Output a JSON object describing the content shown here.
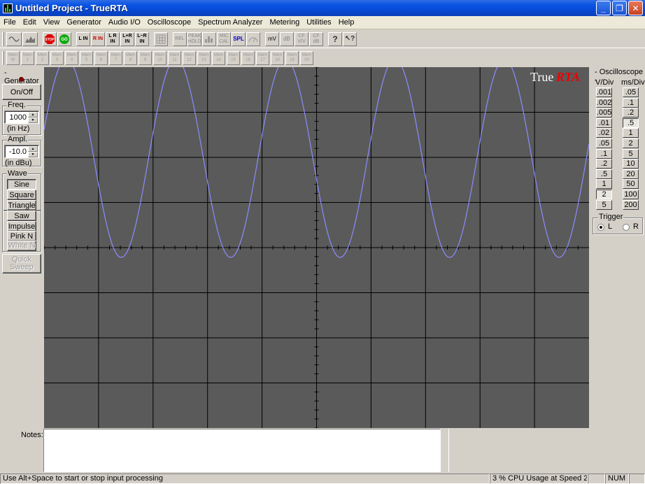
{
  "window": {
    "title": "Untitled Project - TrueRTA",
    "minimize_icon": "minimize-icon",
    "maximize_icon": "restore-icon",
    "close_icon": "close-icon"
  },
  "menu": [
    "File",
    "Edit",
    "View",
    "Generator",
    "Audio I/O",
    "Oscilloscope",
    "Spectrum Analyzer",
    "Metering",
    "Utilities",
    "Help"
  ],
  "toolbar": {
    "buttons": [
      {
        "label": "",
        "icon": "oscilloscope-mode-icon"
      },
      {
        "label": "",
        "icon": "spectrum-mode-icon"
      },
      {
        "label": "STOP",
        "icon": "stop-icon"
      },
      {
        "label": "GO",
        "icon": "go-icon"
      },
      {
        "label": "L IN"
      },
      {
        "label": "R IN"
      },
      {
        "label": "L R IN"
      },
      {
        "label": "L+R IN"
      },
      {
        "label": "L−R IN"
      },
      {
        "label": "",
        "icon": "grid-icon"
      },
      {
        "label": "REL"
      },
      {
        "label": "PEAK HOLD"
      },
      {
        "label": "",
        "icon": "bars-icon"
      },
      {
        "label": "MIC CAL"
      },
      {
        "label": "SPL"
      },
      {
        "label": "",
        "icon": "meter-icon"
      },
      {
        "label": "mV"
      },
      {
        "label": "dB"
      },
      {
        "label": "CF V/V"
      },
      {
        "label": "CF dB"
      },
      {
        "label": "?",
        "icon": "help-icon"
      },
      {
        "label": "",
        "icon": "context-help-icon"
      }
    ],
    "mem_buttons": [
      "Mem W",
      "Mem 1",
      "Mem 2",
      "Mem 3",
      "Mem 4",
      "Mem 5",
      "Mem 6",
      "Mem 7",
      "Mem 8",
      "Mem 9",
      "Mem 10",
      "Mem 11",
      "Mem 12",
      "Mem 13",
      "Mem 14",
      "Mem 15",
      "Mem 16",
      "Mem 17",
      "Mem 18",
      "Mem 19",
      "Mem 20"
    ]
  },
  "generator": {
    "title": "Generator",
    "on_off_label": "On/Off",
    "freq_label": "Freq.",
    "freq_value": "1000",
    "freq_unit": "(in Hz)",
    "ampl_label": "Ampl.",
    "ampl_value": "-10.0",
    "ampl_unit": "(in dBu)",
    "wave_label": "Wave",
    "waves": [
      "Sine",
      "Square",
      "Triangle",
      "Saw",
      "Impulse",
      "Pink N",
      "White N"
    ],
    "selected_wave": "Sine",
    "quick_sweep_label": "Quick Sweep"
  },
  "scope": {
    "logo_true": "True",
    "logo_rta": "RTA",
    "trace_color": "#8c8cff",
    "grid_color": "#000000",
    "background": "#5a5a5a",
    "waveform": {
      "cycles": 5,
      "clipped_bottom": true
    }
  },
  "oscilloscope": {
    "title": "Oscilloscope",
    "vdiv_header": "V/Div",
    "msdiv_header": "ms/Div",
    "vdiv": [
      ".001",
      ".002",
      ".005",
      ".01",
      ".02",
      ".05",
      ".1",
      ".2",
      ".5",
      "1",
      "2",
      "5"
    ],
    "msdiv": [
      ".05",
      ".1",
      ".2",
      ".5",
      "1",
      "2",
      "5",
      "10",
      "20",
      "50",
      "100",
      "200"
    ],
    "selected_vdiv": "2",
    "selected_msdiv": ".5",
    "trigger_label": "Trigger",
    "trigger_l": "L",
    "trigger_r": "R",
    "trigger_selected": "L"
  },
  "notes": {
    "label": "Notes:",
    "value": ""
  },
  "status": {
    "hint": "Use Alt+Space to start or stop input processing",
    "cpu": "3 % CPU Usage at Speed 2",
    "num": "NUM"
  }
}
